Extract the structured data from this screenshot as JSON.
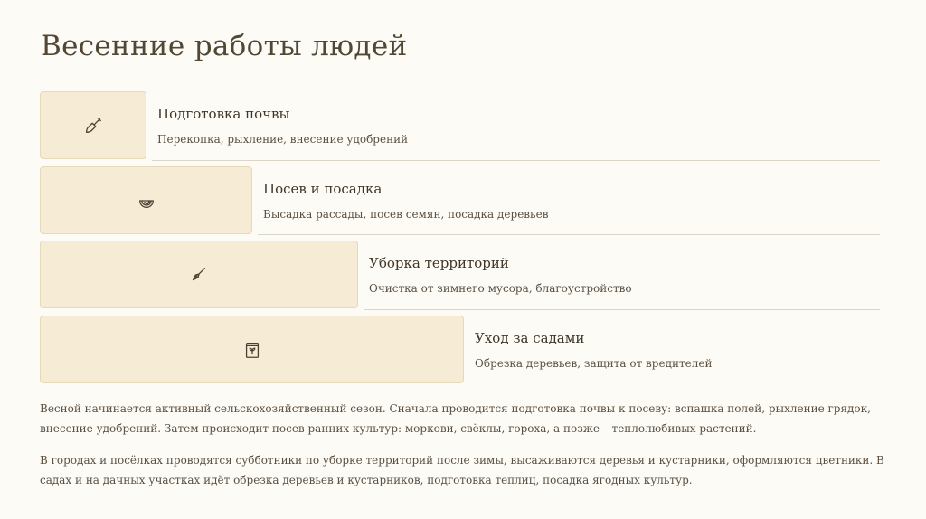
{
  "page": {
    "title": "Весенние работы людей"
  },
  "steps": [
    {
      "icon": "shovel-icon",
      "title": "Подготовка почвы",
      "description": "Перекопка, рыхление, внесение удобрений"
    },
    {
      "icon": "watermelon-icon",
      "title": "Посев и посадка",
      "description": "Высадка рассады, посев семян, посадка деревьев"
    },
    {
      "icon": "broom-icon",
      "title": "Уборка территорий",
      "description": "Очистка от зимнего мусора, благоустройство"
    },
    {
      "icon": "seed-packet-icon",
      "title": "Уход за садами",
      "description": "Обрезка деревьев, защита от вредителей"
    }
  ],
  "paragraphs": [
    "Весной начинается активный сельскохозяйственный сезон. Сначала проводится подготовка почвы к посеву: вспашка полей, рыхление грядок, внесение удобрений. Затем происходит посев ранних культур: моркови, свёклы, гороха, а позже – теплолюбивых растений.",
    "В городах и посёлках проводятся субботники по уборке территорий после зимы, высаживаются деревья и кустарники, оформляются цветники. В садах и на дачных участках идёт обрезка деревьев и кустарников, подготовка теплиц, посадка ягодных культур."
  ],
  "colors": {
    "background": "#fdfbf6",
    "box_fill": "#f6ecd6",
    "box_border": "#e6d8b8",
    "text": "#4a4032"
  }
}
